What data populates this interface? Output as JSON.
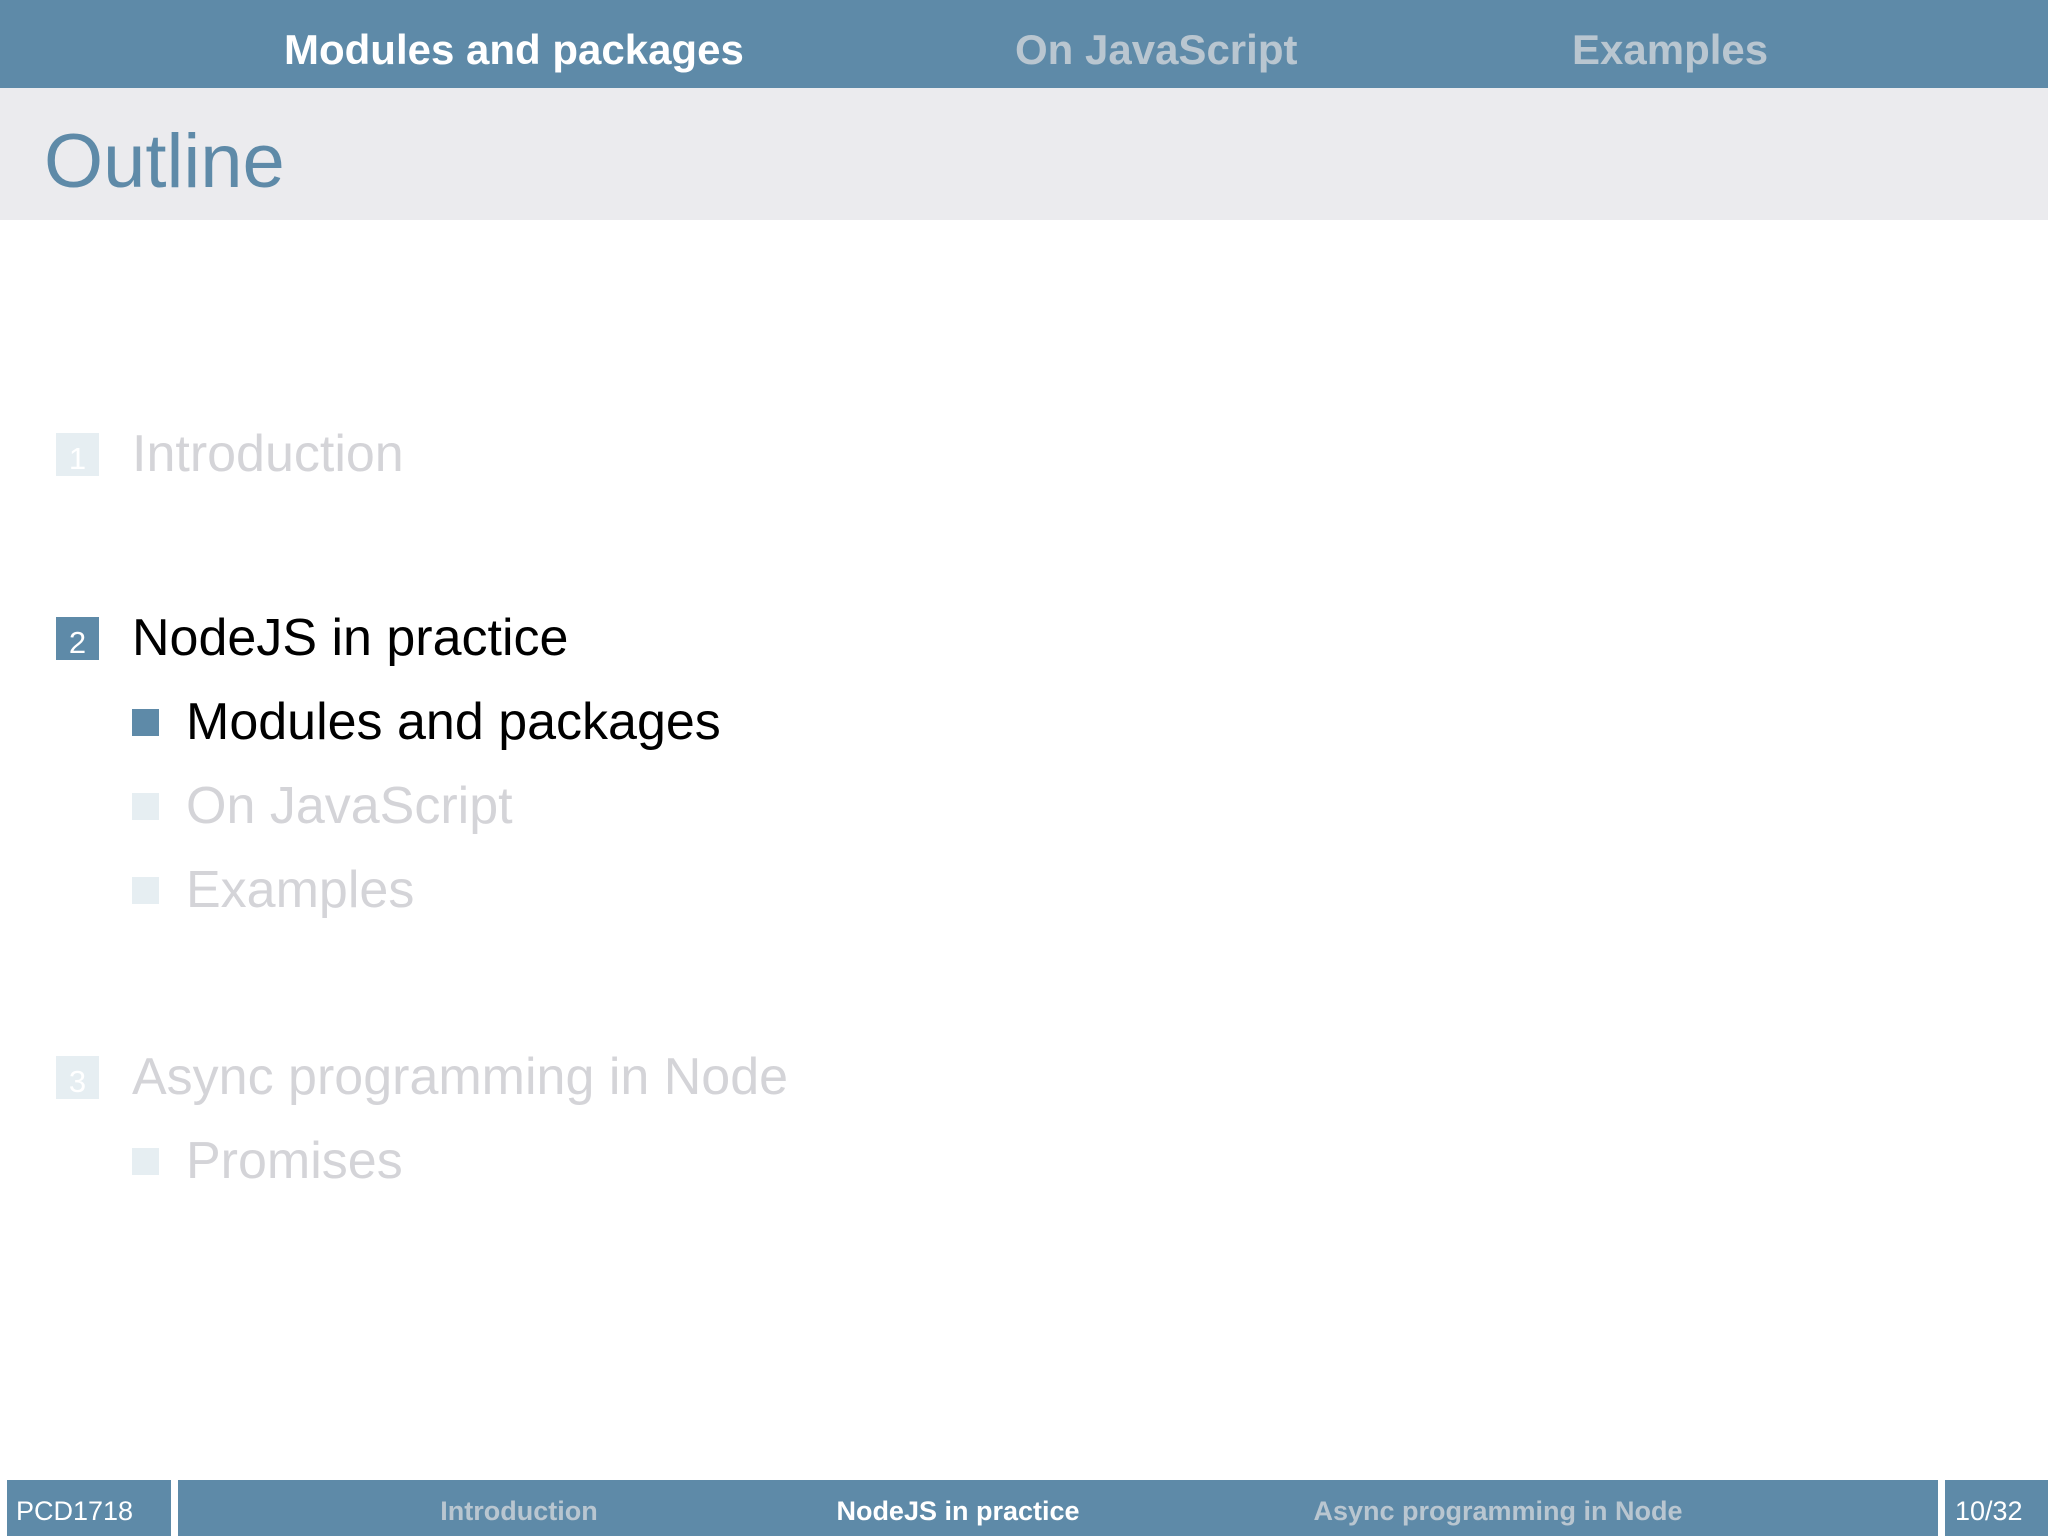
{
  "top_nav": {
    "items": [
      {
        "label": "Modules and packages",
        "state": "active"
      },
      {
        "label": "On JavaScript",
        "state": "inactive"
      },
      {
        "label": "Examples",
        "state": "inactive"
      }
    ]
  },
  "frame_title": "Outline",
  "outline": {
    "sections": [
      {
        "number": "1",
        "label": "Introduction",
        "state": "dimmed",
        "subsections": []
      },
      {
        "number": "2",
        "label": "NodeJS in practice",
        "state": "current",
        "subsections": [
          {
            "label": "Modules and packages",
            "state": "current"
          },
          {
            "label": "On JavaScript",
            "state": "dimmed"
          },
          {
            "label": "Examples",
            "state": "dimmed"
          }
        ]
      },
      {
        "number": "3",
        "label": "Async programming in Node",
        "state": "dimmed",
        "subsections": [
          {
            "label": "Promises",
            "state": "dimmed"
          }
        ]
      }
    ]
  },
  "footer": {
    "course": "PCD1718",
    "sections": [
      {
        "label": "Introduction",
        "state": "inactive"
      },
      {
        "label": "NodeJS in practice",
        "state": "active"
      },
      {
        "label": "Async programming in Node",
        "state": "inactive"
      }
    ],
    "page": "10/32"
  },
  "colors": {
    "accent": "#5e8aa8",
    "title_band": "#ebebee",
    "dimmed_text": "#d4d4d8",
    "dimmed_marker": "#e6eef2",
    "inactive_nav_text": "#b9c6d0"
  }
}
